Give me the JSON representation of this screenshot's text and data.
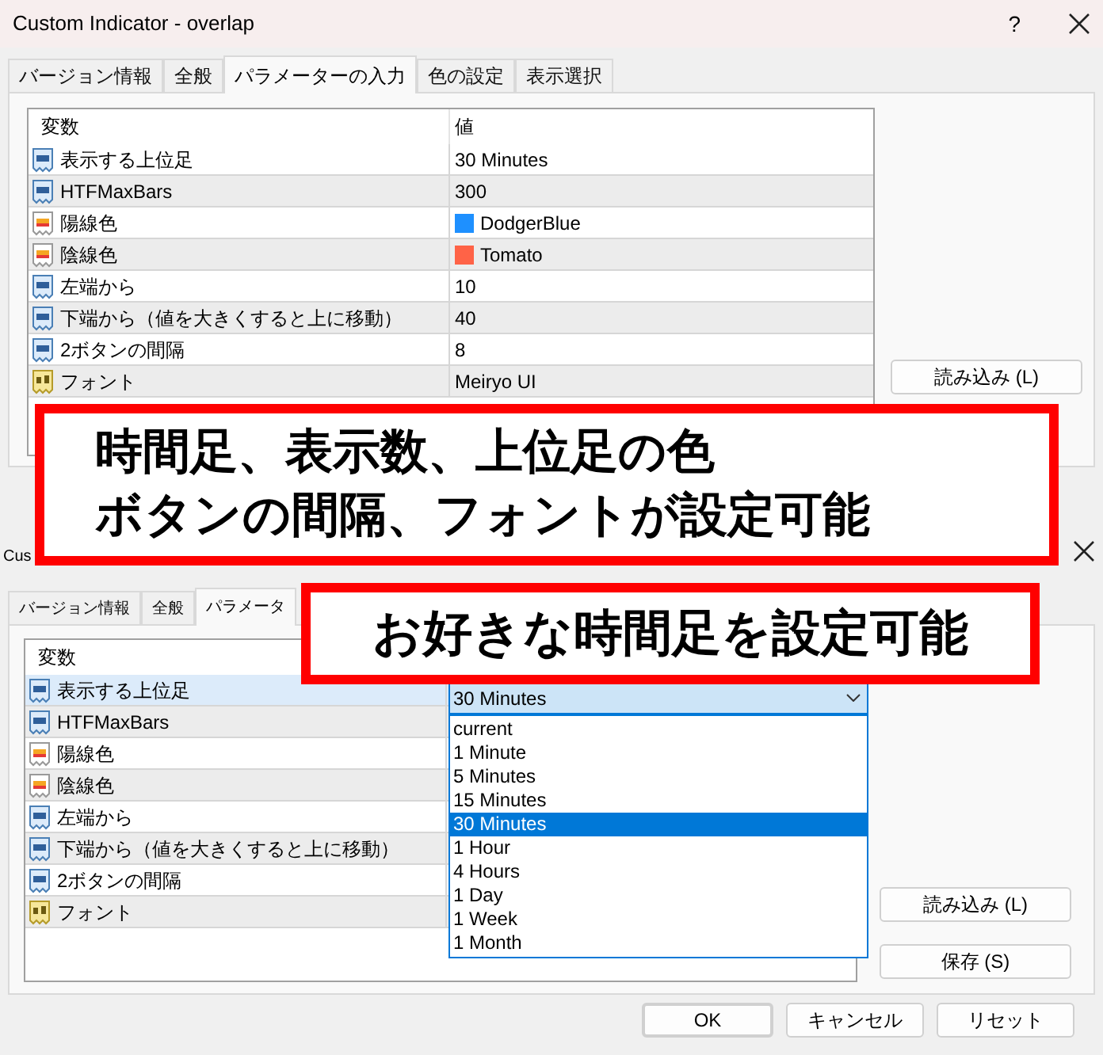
{
  "windows": [
    {
      "title": "Custom Indicator - overlap",
      "help": "?",
      "tabs": [
        {
          "label": "バージョン情報",
          "selected": false
        },
        {
          "label": "全般",
          "selected": false
        },
        {
          "label": "パラメーターの入力",
          "selected": true
        },
        {
          "label": "色の設定",
          "selected": false
        },
        {
          "label": "表示選択",
          "selected": false
        }
      ],
      "table": {
        "columns": [
          "変数",
          "値"
        ],
        "rows": [
          {
            "kind": "number",
            "name": "表示する上位足",
            "value": "30 Minutes",
            "selected": false
          },
          {
            "kind": "number",
            "name": "HTFMaxBars",
            "value": "300",
            "selected": false
          },
          {
            "kind": "color",
            "name": "陽線色",
            "value": "DodgerBlue",
            "color": "#1e90ff",
            "selected": false
          },
          {
            "kind": "color",
            "name": "陰線色",
            "value": "Tomato",
            "color": "#ff6347",
            "selected": false
          },
          {
            "kind": "number",
            "name": "左端から",
            "value": "10",
            "selected": false
          },
          {
            "kind": "number",
            "name": "下端から（値を大きくすると上に移動）",
            "value": "40",
            "selected": false
          },
          {
            "kind": "number",
            "name": "2ボタンの間隔",
            "value": "8",
            "selected": false
          },
          {
            "kind": "text",
            "name": "フォント",
            "value": "Meiryo UI",
            "selected": false
          }
        ]
      },
      "buttons": [
        "読み込み (L)"
      ]
    },
    {
      "title": "Cus",
      "tabs": [
        {
          "label": "バージョン情報",
          "selected": false
        },
        {
          "label": "全般",
          "selected": false
        },
        {
          "label": "パラメータ",
          "selected": true
        }
      ],
      "table": {
        "columns": [
          "変数"
        ],
        "rows": [
          {
            "kind": "number",
            "name": "表示する上位足",
            "selected": true
          },
          {
            "kind": "number",
            "name": "HTFMaxBars",
            "selected": false
          },
          {
            "kind": "color",
            "name": "陽線色",
            "selected": false
          },
          {
            "kind": "color",
            "name": "陰線色",
            "selected": false
          },
          {
            "kind": "number",
            "name": "左端から",
            "selected": false
          },
          {
            "kind": "number",
            "name": "下端から（値を大きくすると上に移動）",
            "selected": false
          },
          {
            "kind": "number",
            "name": "2ボタンの間隔",
            "selected": false
          },
          {
            "kind": "text",
            "name": "フォント",
            "selected": false
          }
        ]
      },
      "dropdown": {
        "value": "30 Minutes",
        "options": [
          {
            "label": "current",
            "selected": false
          },
          {
            "label": "1 Minute",
            "selected": false
          },
          {
            "label": "5 Minutes",
            "selected": false
          },
          {
            "label": "15 Minutes",
            "selected": false
          },
          {
            "label": "30 Minutes",
            "selected": true
          },
          {
            "label": "1 Hour",
            "selected": false
          },
          {
            "label": "4 Hours",
            "selected": false
          },
          {
            "label": "1 Day",
            "selected": false
          },
          {
            "label": "1 Week",
            "selected": false
          },
          {
            "label": "1 Month",
            "selected": false
          }
        ]
      },
      "buttons": [
        "読み込み (L)",
        "保存 (S)"
      ],
      "footer_buttons": [
        "OK",
        "キャンセル",
        "リセット"
      ]
    }
  ],
  "callouts": [
    {
      "lines": [
        "時間足、表示数、上位足の色",
        "ボタンの間隔、フォントが設定可能"
      ]
    },
    {
      "lines": [
        "お好きな時間足を設定可能"
      ]
    }
  ]
}
